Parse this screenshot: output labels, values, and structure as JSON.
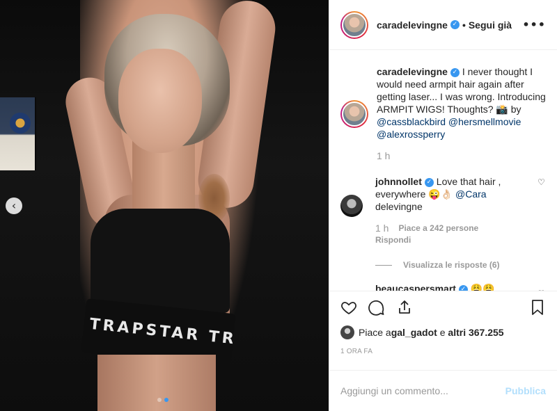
{
  "header": {
    "username": "caradelevingne",
    "separator": "•",
    "follow_label": "Segui già",
    "more_label": "•••"
  },
  "photo": {
    "band_text": "TRAPSTAR TRAPSTAR",
    "prev_label": "‹",
    "carousel_count": 2,
    "carousel_active": 2
  },
  "caption": {
    "username": "caradelevingne",
    "text_1": " I never thought I would need armpit hair again after getting laser... I was wrong. Introducing ARMPIT WIGS! Thoughts? 📸 by ",
    "mention_1": "@cassblackbird",
    "mention_2": "@hersmellmovie",
    "mention_3": "@alexrossperry",
    "time": "1 h"
  },
  "comments": [
    {
      "username": "johnnollet",
      "text": " Love that hair , everywhere 😜👌🏻 ",
      "mention": "@Cara",
      "text_after": " delevingne",
      "time": "1 h",
      "likes": "Piace a 242 persone",
      "reply": "Rispondi",
      "view_replies": "Visualizza le risposte (6)"
    },
    {
      "username": "beaucaspersmart",
      "text": " 😩😩"
    }
  ],
  "likes": {
    "prefix": "Piace a ",
    "user": "gal_gadot",
    "middle": " e ",
    "others": "altri 367.255"
  },
  "timestamp": "1 ora fa",
  "add_comment": {
    "placeholder": "Aggiungi un commento...",
    "publish_label": "Pubblica"
  },
  "colors": {
    "accent": "#3897f0",
    "mention": "#003569",
    "muted": "#999999",
    "publish_disabled": "#b2dffc"
  }
}
